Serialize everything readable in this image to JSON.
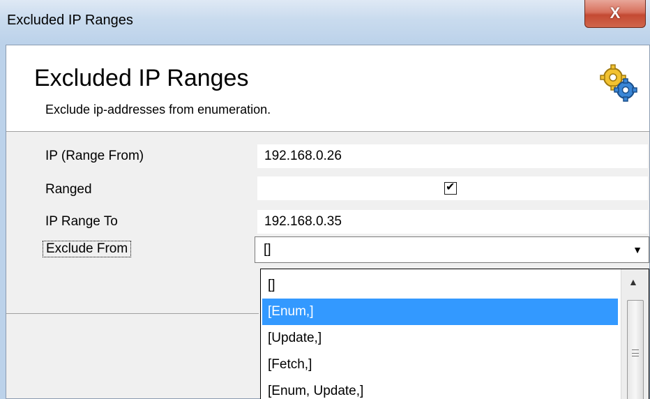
{
  "window": {
    "title": "Excluded IP Ranges",
    "close_glyph": "X"
  },
  "header": {
    "title": "Excluded IP Ranges",
    "subtitle": "Exclude ip-addresses from enumeration.",
    "icon": "gears-icon"
  },
  "properties": {
    "ip_from_label": "IP (Range From)",
    "ip_from_value": "192.168.0.26",
    "ranged_label": "Ranged",
    "ranged_checked": true,
    "check_glyph": "✔",
    "ip_to_label": "IP Range To",
    "ip_to_value": "192.168.0.35",
    "exclude_from_label": "Exclude From",
    "exclude_from_value": "[]"
  },
  "dropdown": {
    "items": [
      "[]",
      "[Enum,]",
      "[Update,]",
      "[Fetch,]",
      "[Enum, Update,]"
    ],
    "selected_index": 1,
    "arrow_glyph": "▼",
    "scroll_up_glyph": "▲"
  },
  "colors": {
    "selection": "#3399ff",
    "title_bar": "#c9dbee",
    "close_button": "#c44a33"
  }
}
